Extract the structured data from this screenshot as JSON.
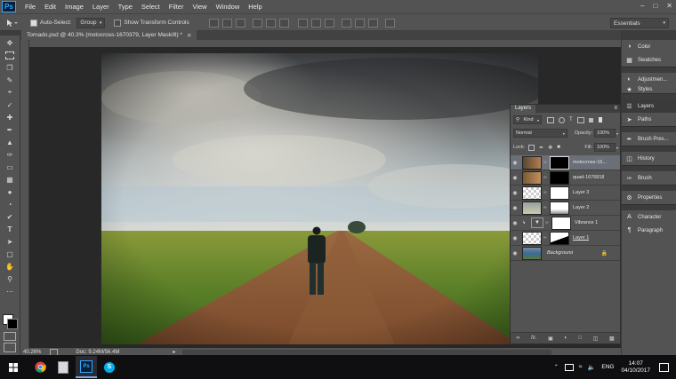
{
  "app": {
    "logo": "Ps"
  },
  "menu": [
    "File",
    "Edit",
    "Image",
    "Layer",
    "Type",
    "Select",
    "Filter",
    "View",
    "Window",
    "Help"
  ],
  "options": {
    "auto_select_label": "Auto-Select:",
    "auto_select_value": "Group",
    "transform_label": "Show Transform Controls",
    "workspace": "Essentials"
  },
  "document": {
    "tab_title": "Tornado.psd @ 40.3% (motocross-1670379, Layer Mask/8) *",
    "zoom": "40.26%",
    "doc_info": "Doc: 9.24M/56.4M"
  },
  "right_panels": [
    {
      "label": "Color",
      "icon": "color-icon"
    },
    {
      "label": "Swatches",
      "icon": "swatches-icon"
    },
    {
      "label": "Adjustmen...",
      "icon": "adjustments-icon"
    },
    {
      "label": "Styles",
      "icon": "styles-icon"
    },
    {
      "label": "Layers",
      "icon": "layers-icon"
    },
    {
      "label": "Paths",
      "icon": "paths-icon"
    },
    {
      "label": "Brush Pres...",
      "icon": "brush-presets-icon"
    },
    {
      "label": "History",
      "icon": "history-icon"
    },
    {
      "label": "Brush",
      "icon": "brush-icon"
    },
    {
      "label": "Properties",
      "icon": "properties-icon"
    },
    {
      "label": "Character",
      "icon": "character-icon"
    },
    {
      "label": "Paragraph",
      "icon": "paragraph-icon"
    }
  ],
  "layers_panel": {
    "tab": "Layers",
    "filter": "Kind",
    "blend_mode": "Normal",
    "opacity_label": "Opacity:",
    "opacity": "100%",
    "lock_label": "Lock:",
    "fill_label": "Fill:",
    "fill": "100%",
    "layers": [
      {
        "name": "motocross-16...",
        "selected": true
      },
      {
        "name": "quad-1676818",
        "selected": false
      },
      {
        "name": "Layer 3",
        "selected": false
      },
      {
        "name": "Layer 2",
        "selected": false
      },
      {
        "name": "Vibrance 1",
        "selected": false
      },
      {
        "name": "Layer 1",
        "selected": false
      },
      {
        "name": "Background",
        "selected": false
      }
    ]
  },
  "taskbar": {
    "language": "ENG",
    "time": "14:07",
    "date": "04/10/2017"
  },
  "colors": {
    "ui_panel": "#535353",
    "ui_dark": "#282828",
    "selection": "#6a6f78",
    "ps_blue": "#31a8ff"
  }
}
